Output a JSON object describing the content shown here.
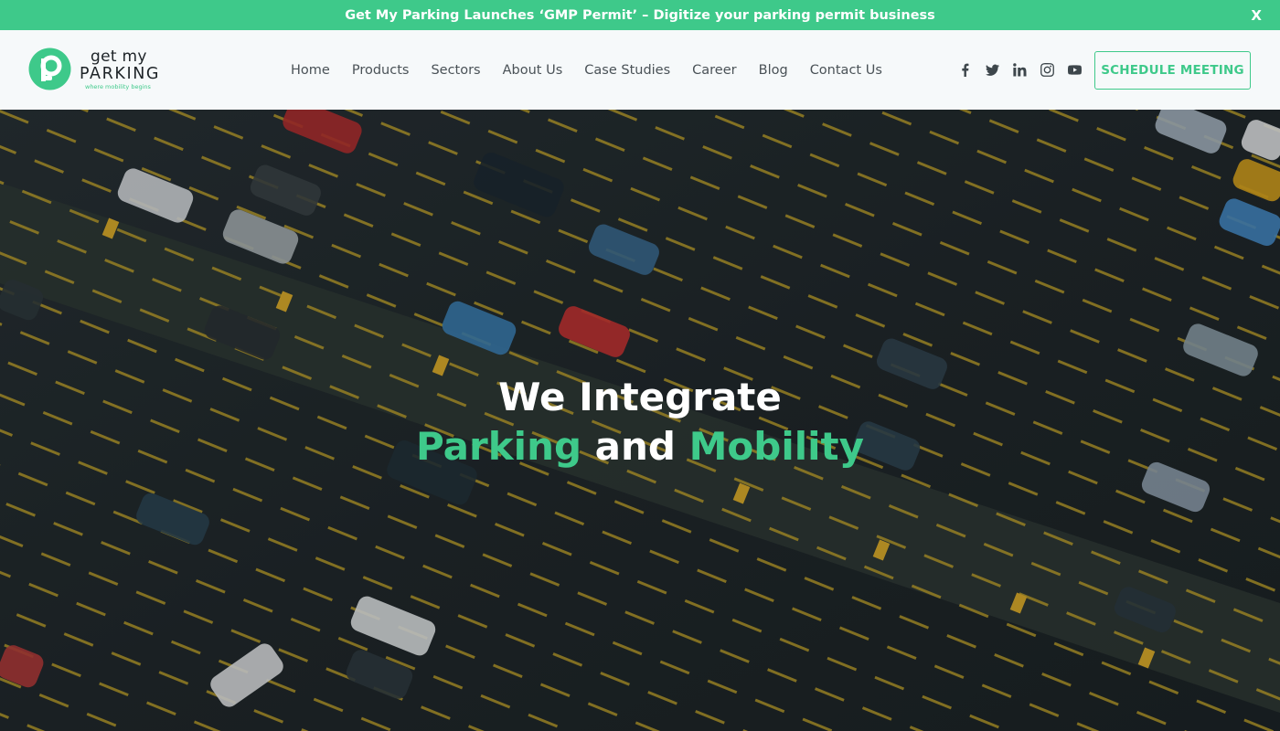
{
  "announcement": {
    "text": "Get My Parking Launches ‘GMP Permit’ – Digitize your parking permit business",
    "close": "X"
  },
  "logo": {
    "line1": "get my",
    "line2": "PARKING",
    "tagline": "where mobility begins"
  },
  "nav": {
    "items": [
      "Home",
      "Products",
      "Sectors",
      "About Us",
      "Case Studies",
      "Career",
      "Blog",
      "Contact Us"
    ]
  },
  "social": [
    "facebook-icon",
    "twitter-icon",
    "linkedin-icon",
    "instagram-icon",
    "youtube-icon"
  ],
  "cta": {
    "label": "SCHEDULE MEETING"
  },
  "hero": {
    "line1": "We Integrate",
    "word1": "Parking",
    "word2": "and",
    "word3": "Mobility"
  },
  "colors": {
    "brand_green": "#3ec98a",
    "header_bg": "#f6f9fa",
    "hero_bg": "#222a2e",
    "parking_line": "#e2c02c"
  }
}
